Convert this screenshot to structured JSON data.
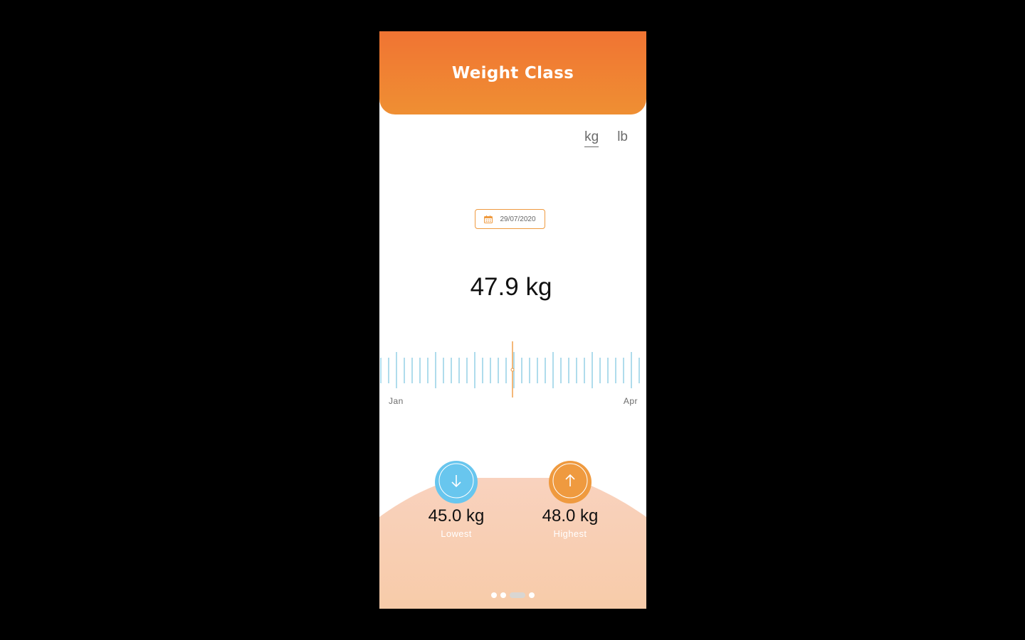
{
  "header": {
    "title": "Weight Class"
  },
  "units": {
    "kg_label": "kg",
    "lb_label": "lb",
    "selected": "kg"
  },
  "date_picker": {
    "value": "29/07/2020",
    "icon": "calendar-icon"
  },
  "current_weight": {
    "display": "47.9 kg"
  },
  "timeline": {
    "start_label": "Jan",
    "end_label": "Apr"
  },
  "stats": {
    "lowest": {
      "value": "45.0 kg",
      "label": "Lowest",
      "icon": "arrow-down-icon"
    },
    "highest": {
      "value": "48.0 kg",
      "label": "Highest",
      "icon": "arrow-up-icon"
    }
  },
  "pagination": {
    "total": 4,
    "active_index": 2
  },
  "colors": {
    "header_top": "#f07433",
    "header_bottom": "#ef8f33",
    "accent_orange": "#ef9a3f",
    "accent_blue": "#68c6ee",
    "ruler_tick": "#5fb8d8",
    "bottom_panel": "#f9d3bd"
  }
}
